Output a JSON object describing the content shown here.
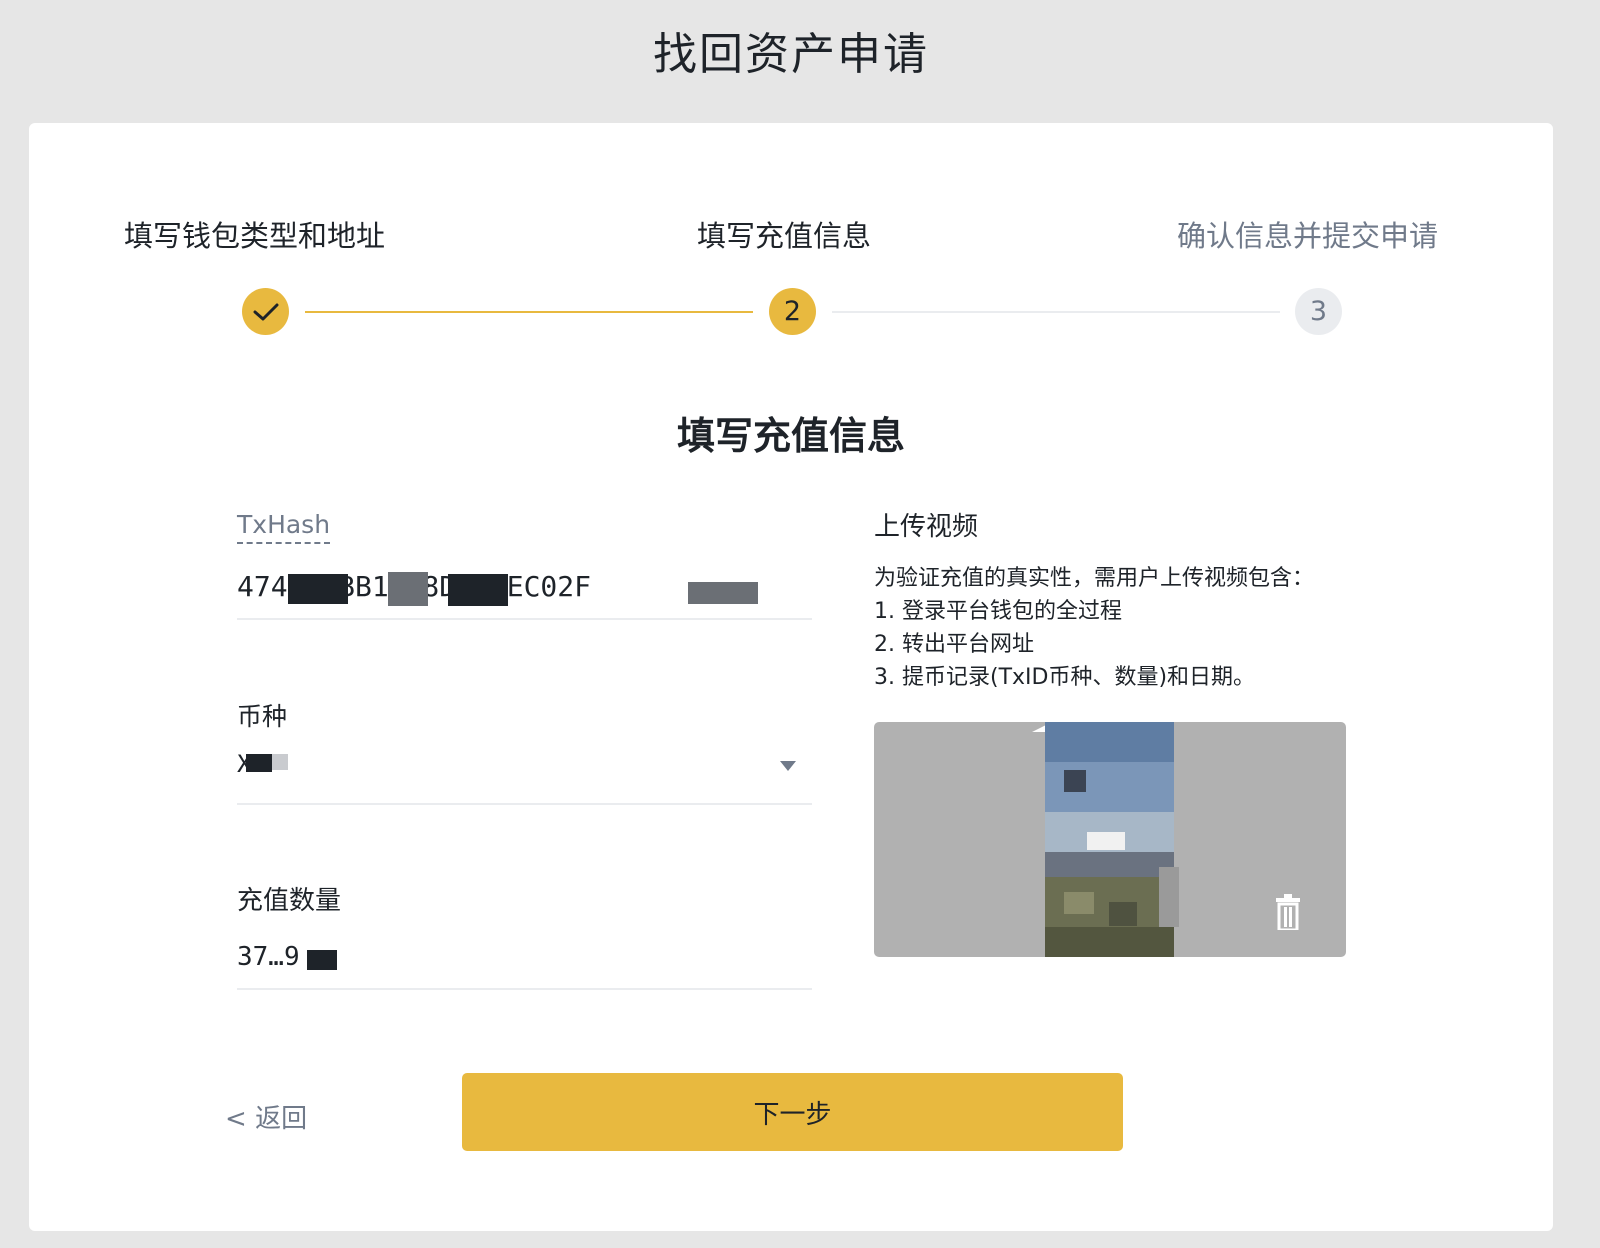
{
  "page": {
    "title": "找回资产申请"
  },
  "steps": [
    {
      "label": "填写钱包类型和地址",
      "status": "done",
      "marker": "✓"
    },
    {
      "label": "填写充值信息",
      "status": "active",
      "marker": "2"
    },
    {
      "label": "确认信息并提交申请",
      "status": "todo",
      "marker": "3"
    }
  ],
  "section": {
    "title": "填写充值信息"
  },
  "form": {
    "txhash": {
      "label": "TxHash",
      "value": "474A…BBB1CA8D7E2EC02F"
    },
    "coin": {
      "label": "币种",
      "value": "XRP"
    },
    "amount": {
      "label": "充值数量",
      "value": "37…9"
    }
  },
  "upload": {
    "title": "上传视频",
    "instructions": [
      "为验证充值的真实性，需用户上传视频包含：",
      "1. 登录平台钱包的全过程",
      "2. 转出平台网址",
      "3. 提币记录(TxID币种、数量)和日期。"
    ]
  },
  "actions": {
    "back_label": "返回",
    "next_label": "下一步"
  },
  "icons": {
    "check": "check-icon",
    "dropdown": "caret-down-icon",
    "delete": "trash-icon",
    "back": "chevron-left-icon"
  },
  "colors": {
    "accent": "#e8b93f",
    "text": "#1e2329",
    "muted": "#707a8a",
    "divider": "#eaecef",
    "background": "#e6e6e6"
  }
}
